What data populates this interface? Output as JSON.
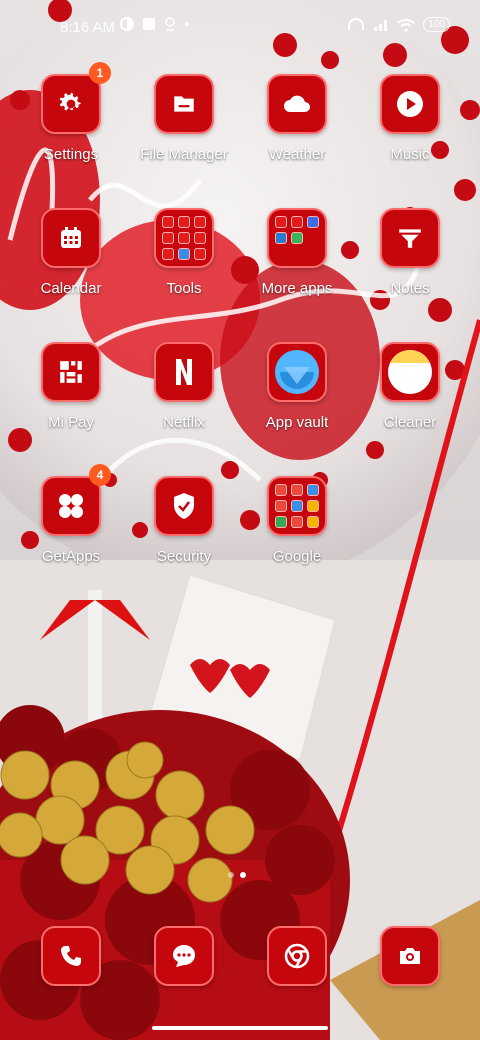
{
  "status_bar": {
    "time": "8:16 AM",
    "battery": "100",
    "left_icons": [
      "moon-icon",
      "square-icon",
      "location-icon",
      "dot-icon"
    ],
    "right_icons": [
      "headset-icon",
      "signal-icon",
      "wifi-icon"
    ]
  },
  "apps": [
    {
      "id": "settings",
      "label": "Settings",
      "icon": "gear-icon",
      "badge": "1"
    },
    {
      "id": "file-manager",
      "label": "File Manager",
      "icon": "folder-icon"
    },
    {
      "id": "weather",
      "label": "Weather",
      "icon": "cloud-icon"
    },
    {
      "id": "music",
      "label": "Music",
      "icon": "play-icon"
    },
    {
      "id": "calendar",
      "label": "Calendar",
      "icon": "calendar-icon"
    },
    {
      "id": "tools",
      "label": "Tools",
      "icon": "folder-grid-icon"
    },
    {
      "id": "more-apps",
      "label": "More apps",
      "icon": "folder-grid-icon"
    },
    {
      "id": "notes",
      "label": "Notes",
      "icon": "funnel-icon"
    },
    {
      "id": "mi-pay",
      "label": "Mi Pay",
      "icon": "mipay-icon"
    },
    {
      "id": "netflix",
      "label": "Netflix",
      "icon": "netflix-icon"
    },
    {
      "id": "app-vault",
      "label": "App vault",
      "icon": "appvault-icon"
    },
    {
      "id": "cleaner",
      "label": "Cleaner",
      "icon": "cleaner-icon"
    },
    {
      "id": "getapps",
      "label": "GetApps",
      "icon": "four-dots-icon",
      "badge": "4"
    },
    {
      "id": "security",
      "label": "Security",
      "icon": "shield-check-icon"
    },
    {
      "id": "google",
      "label": "Google",
      "icon": "folder-grid-icon"
    }
  ],
  "dock": [
    {
      "id": "phone",
      "icon": "phone-icon"
    },
    {
      "id": "messages",
      "icon": "chat-icon"
    },
    {
      "id": "chrome",
      "icon": "chrome-icon"
    },
    {
      "id": "camera",
      "icon": "camera-icon"
    }
  ],
  "colors": {
    "tile_red": "#c5070d",
    "badge_orange": "#ff5a1f"
  }
}
